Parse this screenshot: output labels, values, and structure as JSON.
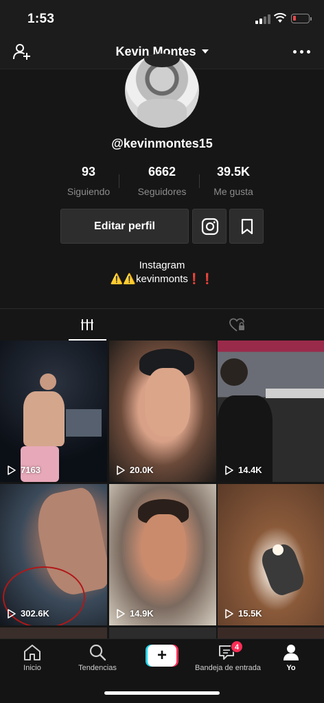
{
  "status_bar": {
    "time": "1:53"
  },
  "header": {
    "title": "Kevin Montes"
  },
  "profile": {
    "handle": "@kevinmontes15"
  },
  "stats": [
    {
      "value": "93",
      "label": "Siguiendo"
    },
    {
      "value": "6662",
      "label": "Seguidores"
    },
    {
      "value": "39.5K",
      "label": "Me gusta"
    }
  ],
  "actions": {
    "edit_label": "Editar perfil"
  },
  "bio": {
    "line1": "Instagram",
    "line2": "⚠️⚠️kevinmonts❗️❗️"
  },
  "videos": [
    {
      "views": "7163"
    },
    {
      "views": "20.0K"
    },
    {
      "views": "14.4K"
    },
    {
      "views": "302.6K"
    },
    {
      "views": "14.9K"
    },
    {
      "views": "15.5K"
    }
  ],
  "bottom_nav": {
    "home": "Inicio",
    "discover": "Tendencias",
    "create": "+",
    "inbox": "Bandeja de entrada",
    "inbox_badge": "4",
    "me": "Yo"
  },
  "colors": {
    "accent_red": "#fe2c55",
    "accent_cyan": "#20d5ec",
    "background": "#161616"
  }
}
